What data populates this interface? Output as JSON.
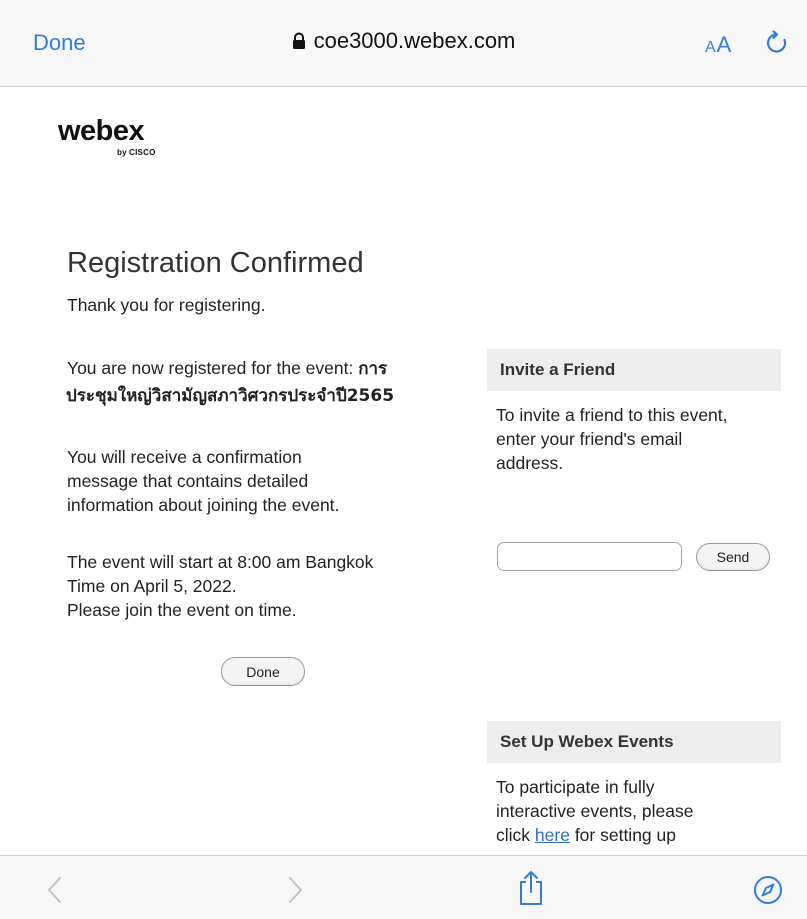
{
  "browser": {
    "done_label": "Done",
    "url": "coe3000.webex.com",
    "text_size_small": "A",
    "text_size_large": "A",
    "accent_color": "#2f7dde"
  },
  "logo": {
    "brand": "webex",
    "byline": "by CISCO"
  },
  "main": {
    "title": "Registration Confirmed",
    "thanks": "Thank you for registering.",
    "registered_prefix": "You are now registered for the event:",
    "event_name_part1": "การ",
    "event_name_part2": "ประชุมใหญ่วิสามัญสภาวิศวกรประจำปี2565",
    "confirmation_lines": [
      "You will receive a confirmation",
      "message that contains detailed",
      "information about joining the event."
    ],
    "start_lines": [
      "The event will start at 8:00 am Bangkok",
      "Time on April 5, 2022.",
      "Please join the event on time."
    ],
    "done_button": "Done"
  },
  "invite": {
    "heading": "Invite a Friend",
    "lines": [
      "To invite a friend to this event,",
      "enter your friend's email",
      "address."
    ],
    "email_value": "",
    "send_button": "Send"
  },
  "setup": {
    "heading": "Set Up Webex Events",
    "line1": "To participate in fully",
    "line2": "interactive events, please",
    "line3_prefix": "click",
    "link_text": "here",
    "line3_suffix": "for setting up"
  },
  "toolbar": {
    "icons": [
      "back-icon",
      "forward-icon",
      "share-icon",
      "compass-icon"
    ]
  }
}
